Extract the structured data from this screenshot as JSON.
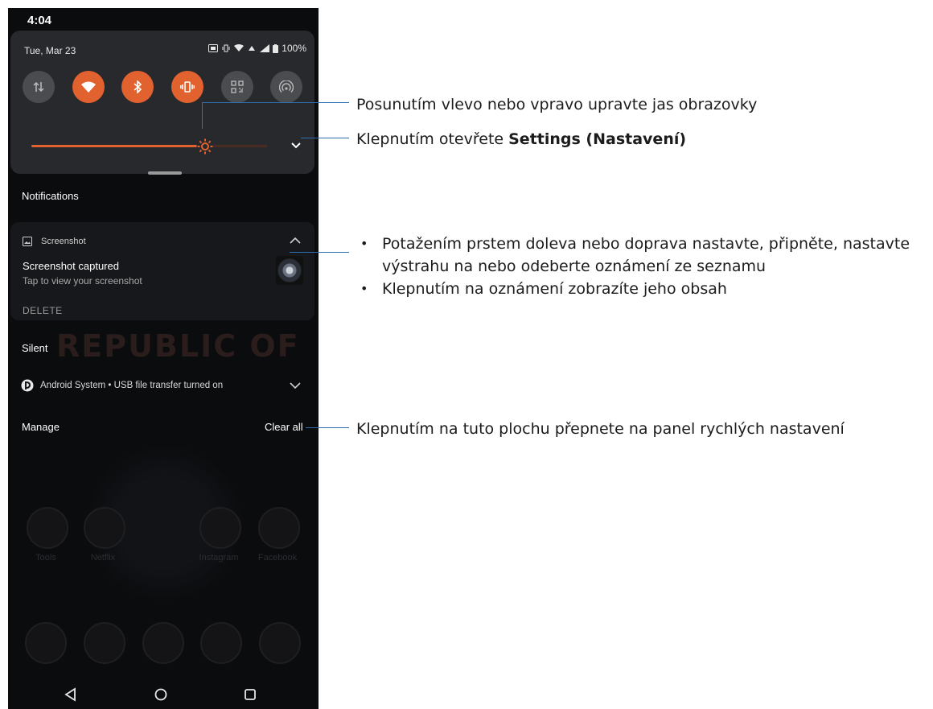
{
  "status_bar": {
    "time": "4:04"
  },
  "quick_settings": {
    "date": "Tue, Mar 23",
    "battery": "100%",
    "tiles": [
      {
        "name": "mobile-data",
        "state": "off"
      },
      {
        "name": "wifi",
        "state": "on"
      },
      {
        "name": "bluetooth",
        "state": "on"
      },
      {
        "name": "vibrate",
        "state": "on"
      },
      {
        "name": "qr-scan",
        "state": "off"
      },
      {
        "name": "hotspot",
        "state": "off"
      }
    ],
    "brightness": 0.73,
    "colors": {
      "accent": "#e2622f",
      "panel": "#27292d",
      "tile_off": "#4a4c50"
    }
  },
  "notifications": {
    "header": "Notifications",
    "card": {
      "app": "Screenshot",
      "title": "Screenshot captured",
      "text": "Tap to view your screenshot",
      "action": "DELETE"
    },
    "silent_header": "Silent",
    "wallpaper_text": "REPUBLIC OF",
    "system_row": "Android System • USB file transfer turned on",
    "manage": "Manage",
    "clear_all": "Clear all"
  },
  "home": {
    "apps": [
      "Tools",
      "Netflix",
      "Instagram",
      "Facebook"
    ]
  },
  "annotations": {
    "brightness": "Posunutím vlevo nebo vpravo upravte jas obrazovky",
    "settings_prefix": "Klepnutím otevřete ",
    "settings_bold": "Settings (Nastavení)",
    "bullets": [
      "Potažením prstem doleva nebo doprava nastavte, připněte, nastavte",
      "výstrahu na nebo odeberte oznámení ze seznamu",
      "Klepnutím na oznámení zobrazíte jeho obsah"
    ],
    "clear_all": "Klepnutím na tuto plochu přepnete na panel rychlých nastavení"
  }
}
